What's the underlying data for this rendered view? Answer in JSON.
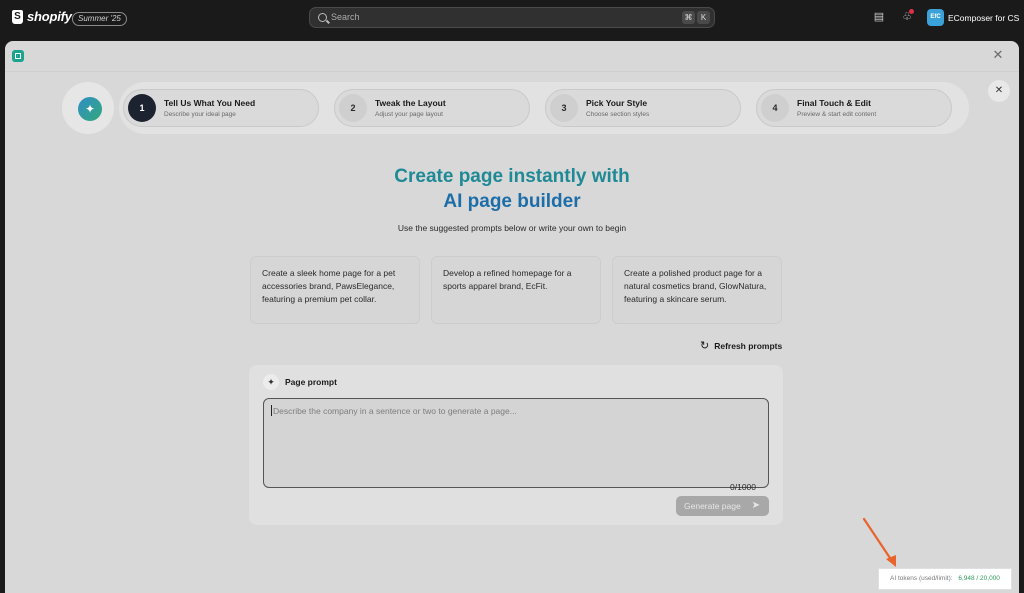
{
  "topbar": {
    "brand": "shopify",
    "edition": "Summer '25",
    "search_placeholder": "Search",
    "shortcut_keys": [
      "⌘",
      "K"
    ],
    "store_initials": "EfC",
    "store_name": "EComposer for CS"
  },
  "stepper": {
    "steps": [
      {
        "num": "1",
        "title": "Tell Us What You Need",
        "subtitle": "Describe your ideal page",
        "active": true
      },
      {
        "num": "2",
        "title": "Tweak the Layout",
        "subtitle": "Adjust your page layout",
        "active": false
      },
      {
        "num": "3",
        "title": "Pick Your Style",
        "subtitle": "Choose section styles",
        "active": false
      },
      {
        "num": "4",
        "title": "Final Touch & Edit",
        "subtitle": "Preview & start edit content",
        "active": false
      }
    ]
  },
  "hero": {
    "title_line1": "Create page instantly with",
    "title_line2": "AI page builder",
    "subtitle": "Use the suggested prompts below or write your own to begin"
  },
  "prompts": [
    "Create a sleek home page for a pet accessories brand, PawsElegance, featuring a premium pet collar.",
    "Develop a refined homepage for a sports apparel brand, EcFit.",
    "Create a polished product page for a natural cosmetics brand, GlowNatura, featuring a skincare serum."
  ],
  "refresh_label": "Refresh prompts",
  "page_prompt": {
    "title": "Page prompt",
    "placeholder": "Describe the company in a sentence or two to generate a page...",
    "counter": "0/1000",
    "generate_label": "Generate page"
  },
  "tokens": {
    "label": "AI tokens (used/limit):",
    "value": "6,948 / 20,000"
  },
  "colors": {
    "accent_teal": "#1f8a96",
    "accent_blue": "#1d6ea8",
    "token_green": "#2e9a5c",
    "arrow_orange": "#e8642c"
  }
}
